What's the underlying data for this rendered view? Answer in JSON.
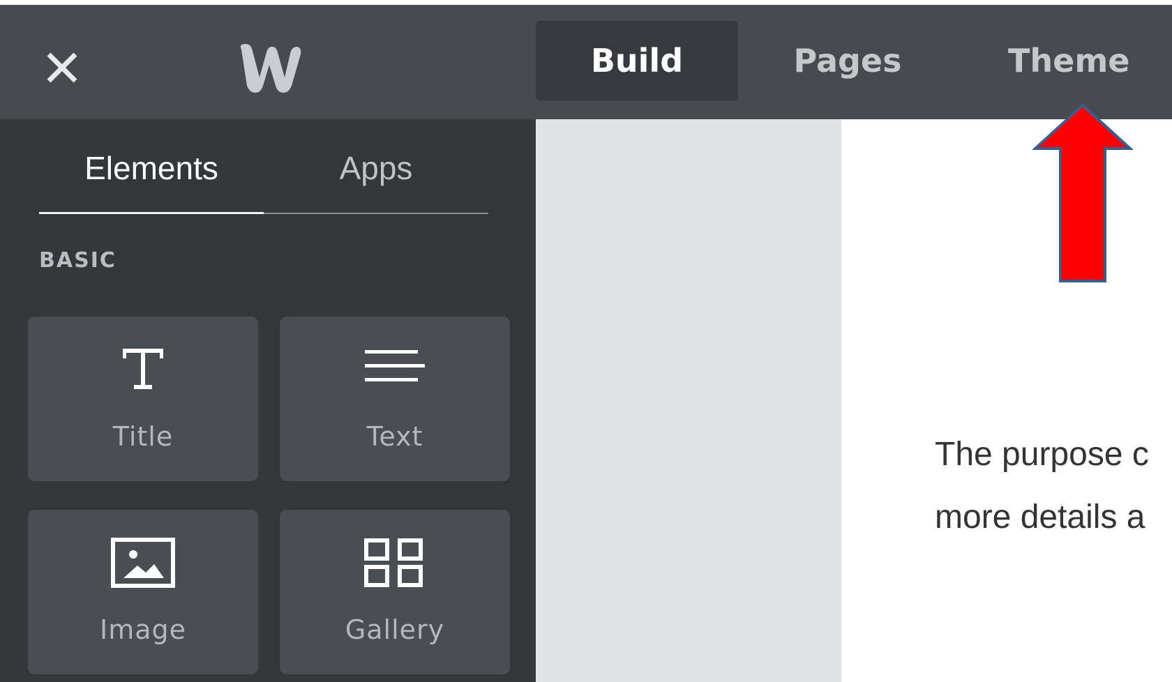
{
  "topbar": {
    "tabs": [
      {
        "label": "Build",
        "active": true
      },
      {
        "label": "Pages",
        "active": false
      },
      {
        "label": "Theme",
        "active": false
      }
    ],
    "close_icon": "close-icon",
    "logo_icon": "weebly-logo"
  },
  "sidebar": {
    "tabs": [
      {
        "label": "Elements",
        "active": true
      },
      {
        "label": "Apps",
        "active": false
      }
    ],
    "section_label": "BASIC",
    "elements": [
      {
        "label": "Title",
        "icon": "title-icon"
      },
      {
        "label": "Text",
        "icon": "text-icon"
      },
      {
        "label": "Image",
        "icon": "image-icon"
      },
      {
        "label": "Gallery",
        "icon": "gallery-icon"
      }
    ]
  },
  "canvas": {
    "paragraph_lines": [
      "The purpose c",
      "more details a"
    ]
  },
  "annotation": {
    "type": "arrow",
    "color": "#ff0000",
    "points_to": "Theme"
  }
}
